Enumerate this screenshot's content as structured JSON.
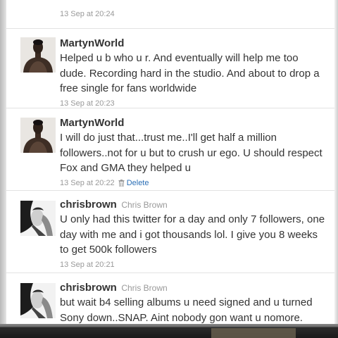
{
  "top_tweet": {
    "timestamp": "13 Sep at 20:24"
  },
  "tweets": [
    {
      "username": "MartynWorld",
      "fullname": "",
      "text": "Helped u b who u r. And eventually will help me too dude. Recording hard in the studio. And about to drop a free single for fans worldwide",
      "timestamp": "13 Sep at 20:23",
      "avatar_icon": "shirtless-man-avatar-icon"
    },
    {
      "username": "MartynWorld",
      "fullname": "",
      "text": "I will do just that...trust me..I'll get half a million followers..not for u but to crush ur ego. U should respect Fox and GMA they helped u",
      "timestamp": "13 Sep at 20:22",
      "delete_label": "Delete",
      "avatar_icon": "shirtless-man-avatar-icon"
    },
    {
      "username": "chrisbrown",
      "fullname": "Chris Brown",
      "text": "U only had this twitter for a day and only 7 followers, one day with me and i got thousands lol. I give you 8 weeks to get 500k followers",
      "timestamp": "13 Sep at 20:21",
      "avatar_icon": "black-white-portrait-avatar-icon"
    },
    {
      "username": "chrisbrown",
      "fullname": "Chris Brown",
      "text": "but wait b4 selling albums u need signed and u turned Sony down..SNAP. Aint nobody gon want u nomore.",
      "avatar_icon": "black-white-portrait-avatar-icon"
    }
  ],
  "colors": {
    "link": "#2b6fb6",
    "text": "#333333",
    "meta": "#999999"
  }
}
